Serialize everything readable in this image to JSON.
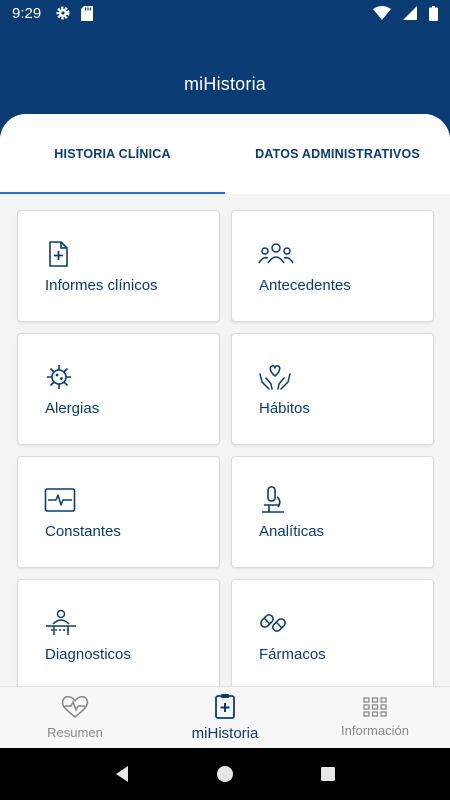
{
  "status_bar": {
    "time": "9:29",
    "left_icons": [
      "gear-icon",
      "sd-card-icon"
    ],
    "right_icons": [
      "wifi-icon",
      "signal-icon",
      "battery-icon"
    ]
  },
  "header": {
    "title": "miHistoria"
  },
  "tabs": [
    {
      "label": "HISTORIA CLÍNICA",
      "active": true
    },
    {
      "label": "DATOS ADMINISTRATIVOS",
      "active": false
    }
  ],
  "cards": [
    {
      "label": "Informes clínicos",
      "icon": "document-plus-icon"
    },
    {
      "label": "Antecedentes",
      "icon": "people-icon"
    },
    {
      "label": "Alergias",
      "icon": "virus-icon"
    },
    {
      "label": "Hábitos",
      "icon": "hands-heart-icon"
    },
    {
      "label": "Constantes",
      "icon": "heart-monitor-icon"
    },
    {
      "label": "Analíticas",
      "icon": "microscope-icon"
    },
    {
      "label": "Diagnosticos",
      "icon": "patient-table-icon"
    },
    {
      "label": "Fármacos",
      "icon": "pills-icon"
    }
  ],
  "bottom_nav": [
    {
      "label": "Resumen",
      "icon": "heartbeat-icon",
      "active": false
    },
    {
      "label": "miHistoria",
      "icon": "clipboard-plus-icon",
      "active": true
    },
    {
      "label": "Información",
      "icon": "grid-icon",
      "active": false
    }
  ],
  "colors": {
    "primary": "#0a3b73",
    "accent": "#2a6fd1",
    "background": "#f4f4f4"
  }
}
